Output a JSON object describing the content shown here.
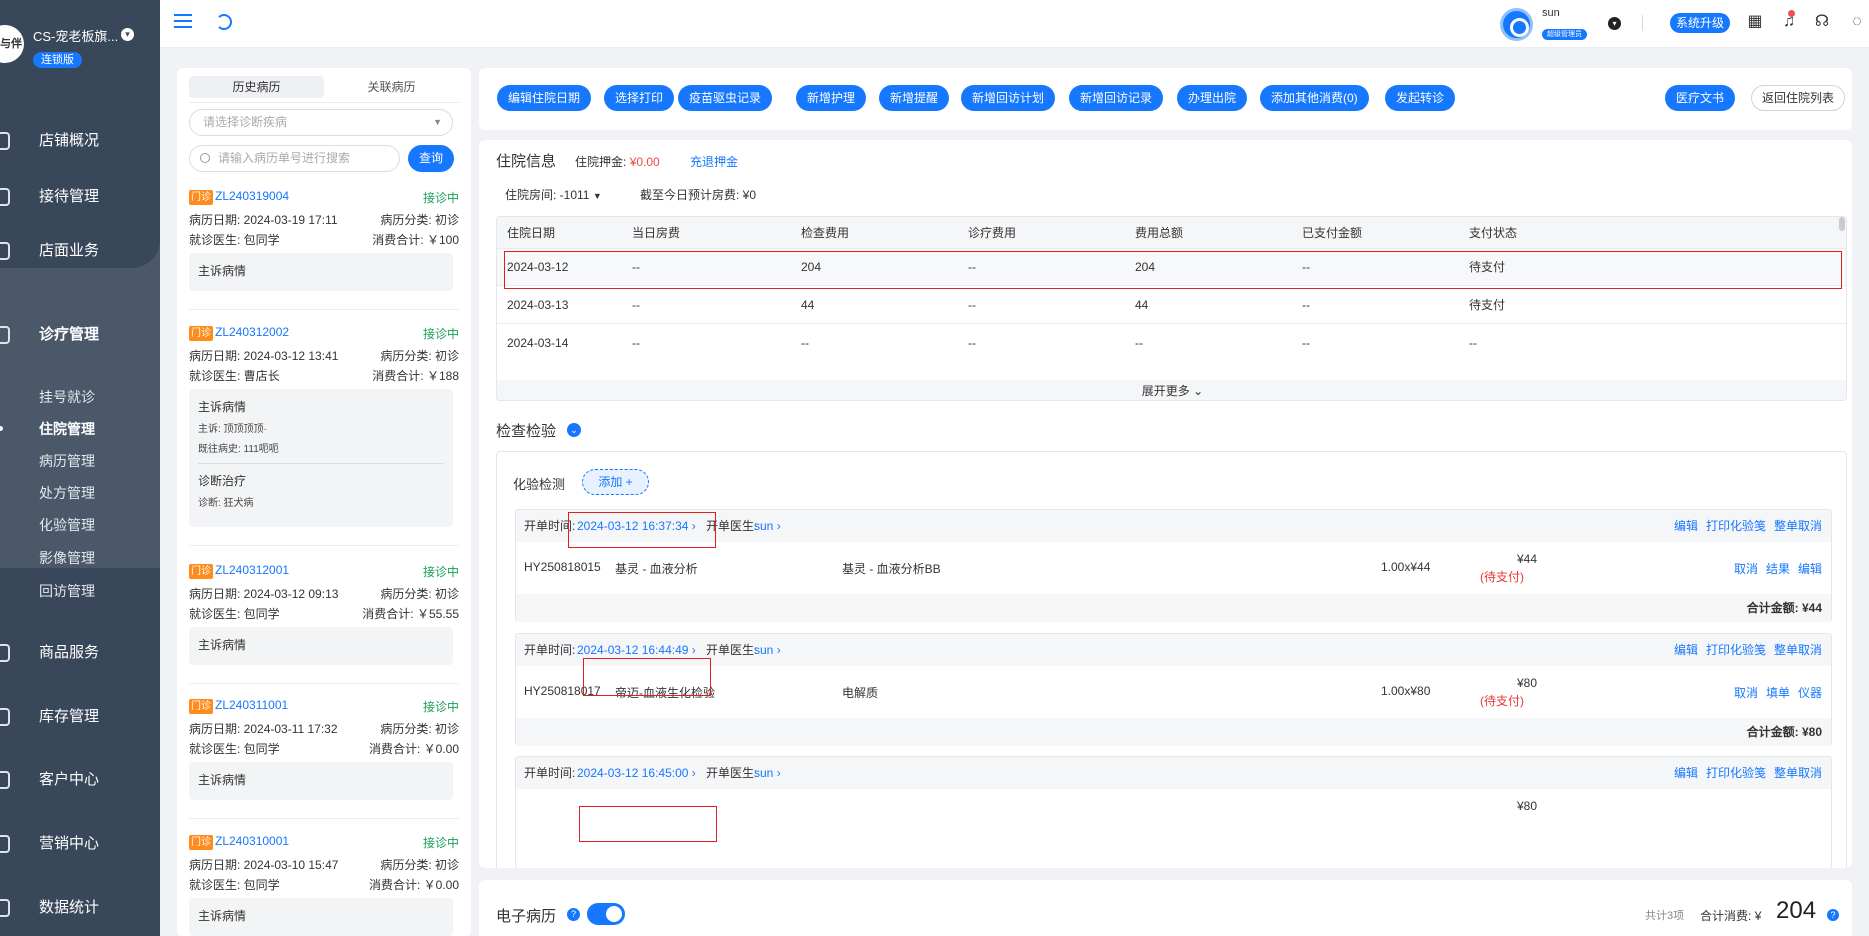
{
  "sidebar": {
    "shop_name": "CS-宠老板旗...",
    "edition": "连锁版",
    "logo_text": "与伴",
    "nav": [
      "店铺概况",
      "接待管理",
      "店面业务",
      "诊疗管理",
      "商品服务",
      "库存管理",
      "客户中心",
      "营销中心",
      "数据统计"
    ],
    "sub": [
      "挂号就诊",
      "住院管理",
      "病历管理",
      "处方管理",
      "化验管理",
      "影像管理",
      "回访管理"
    ]
  },
  "topbar": {
    "username": "sun",
    "role": "超级管理员",
    "upgrade": "系统升级"
  },
  "history": {
    "tabs": [
      "历史病历",
      "关联病历"
    ],
    "diag_placeholder": "请选择诊断疾病",
    "search_placeholder": "请输入病历单号进行搜索",
    "search_btn": "查询",
    "records": [
      {
        "tag": "门诊",
        "no": "ZL240319004",
        "status": "接诊中",
        "date": "病历日期: 2024-03-19 17:11",
        "cat": "病历分类: 初诊",
        "doctor": "就诊医生: 包同学",
        "cost": "消费合计: ￥100",
        "complaint": "主诉病情"
      },
      {
        "tag": "门诊",
        "no": "ZL240312002",
        "status": "接诊中",
        "date": "病历日期: 2024-03-12 13:41",
        "cat": "病历分类: 初诊",
        "doctor": "就诊医生: 曹店长",
        "cost": "消费合计: ￥188",
        "complaint": "主诉病情",
        "complaint_detail": "主诉:  顶顶顶顶·",
        "history": "既往病史:  111呃呃",
        "treat": "诊断治疗",
        "diagnosis": "诊断: 狂犬病"
      },
      {
        "tag": "门诊",
        "no": "ZL240312001",
        "status": "接诊中",
        "date": "病历日期: 2024-03-12 09:13",
        "cat": "病历分类: 初诊",
        "doctor": "就诊医生: 包同学",
        "cost": "消费合计: ￥55.55",
        "complaint": "主诉病情"
      },
      {
        "tag": "门诊",
        "no": "ZL240311001",
        "status": "接诊中",
        "date": "病历日期: 2024-03-11 17:32",
        "cat": "病历分类: 初诊",
        "doctor": "就诊医生: 包同学",
        "cost": "消费合计: ￥0.00",
        "complaint": "主诉病情"
      },
      {
        "tag": "门诊",
        "no": "ZL240310001",
        "status": "接诊中",
        "date": "病历日期: 2024-03-10 15:47",
        "cat": "病历分类: 初诊",
        "doctor": "就诊医生: 包同学",
        "cost": "消费合计: ￥0.00",
        "complaint": "主诉病情"
      }
    ]
  },
  "actions": {
    "buttons": [
      "编辑住院日期",
      "选择打印",
      "疫苗驱虫记录",
      "新增护理",
      "新增提醒",
      "新增回访计划",
      "新增回访记录",
      "办理出院",
      "添加其他消费(0)",
      "发起转诊"
    ],
    "docs": "医疗文书",
    "back": "返回住院列表"
  },
  "stay": {
    "title": "住院信息",
    "deposit_label": "住院押金:",
    "deposit_amount": "¥0.00",
    "refund": "充退押金",
    "room": "住院房间:  -1011",
    "today_fee": "截至今日预计房费: ¥0",
    "columns": [
      "住院日期",
      "当日房费",
      "检查费用",
      "诊疗费用",
      "费用总额",
      "已支付金额",
      "支付状态"
    ],
    "rows": [
      [
        "2024-03-12",
        "--",
        "204",
        "--",
        "204",
        "--",
        "待支付"
      ],
      [
        "2024-03-13",
        "--",
        "44",
        "--",
        "44",
        "--",
        "待支付"
      ],
      [
        "2024-03-14",
        "--",
        "--",
        "--",
        "--",
        "--",
        "--"
      ]
    ],
    "more": "展开更多"
  },
  "exam": {
    "title": "检查检验",
    "lab_title": "化验检测",
    "add": "添加 +",
    "orders": [
      {
        "time_label": "开单时间:",
        "time": "2024-03-12 16:37:34",
        "doctor_label": "开单医生:",
        "doctor": "sun",
        "links": [
          "编辑",
          "打印化验笺",
          "整单取消"
        ],
        "code": "HY250818015",
        "name": "基灵 - 血液分析",
        "sub": "基灵 - 血液分析BB",
        "qty": "1.00x¥44",
        "price": "¥44",
        "pay": "(待支付)",
        "item_links": [
          "取消",
          "结果",
          "编辑"
        ],
        "total": "合计金额: ¥44"
      },
      {
        "time_label": "开单时间:",
        "time": "2024-03-12 16:44:49",
        "doctor_label": "开单医生:",
        "doctor": "sun",
        "links": [
          "编辑",
          "打印化验笺",
          "整单取消"
        ],
        "code": "HY250818017",
        "name": "帝迈-血液生化检验",
        "sub": "电解质",
        "qty": "1.00x¥80",
        "price": "¥80",
        "pay": "(待支付)",
        "item_links": [
          "取消",
          "填单",
          "仪器"
        ],
        "total": "合计金额: ¥80"
      },
      {
        "time_label": "开单时间:",
        "time": "2024-03-12 16:45:00",
        "doctor_label": "开单医生:",
        "doctor": "sun",
        "links": [
          "编辑",
          "打印化验笺",
          "整单取消"
        ],
        "price": "¥80"
      }
    ]
  },
  "emr": {
    "title": "电子病历",
    "count": "共计3项",
    "sum_label": "合计消费:",
    "sum_currency": "¥",
    "sum_value": "204"
  }
}
